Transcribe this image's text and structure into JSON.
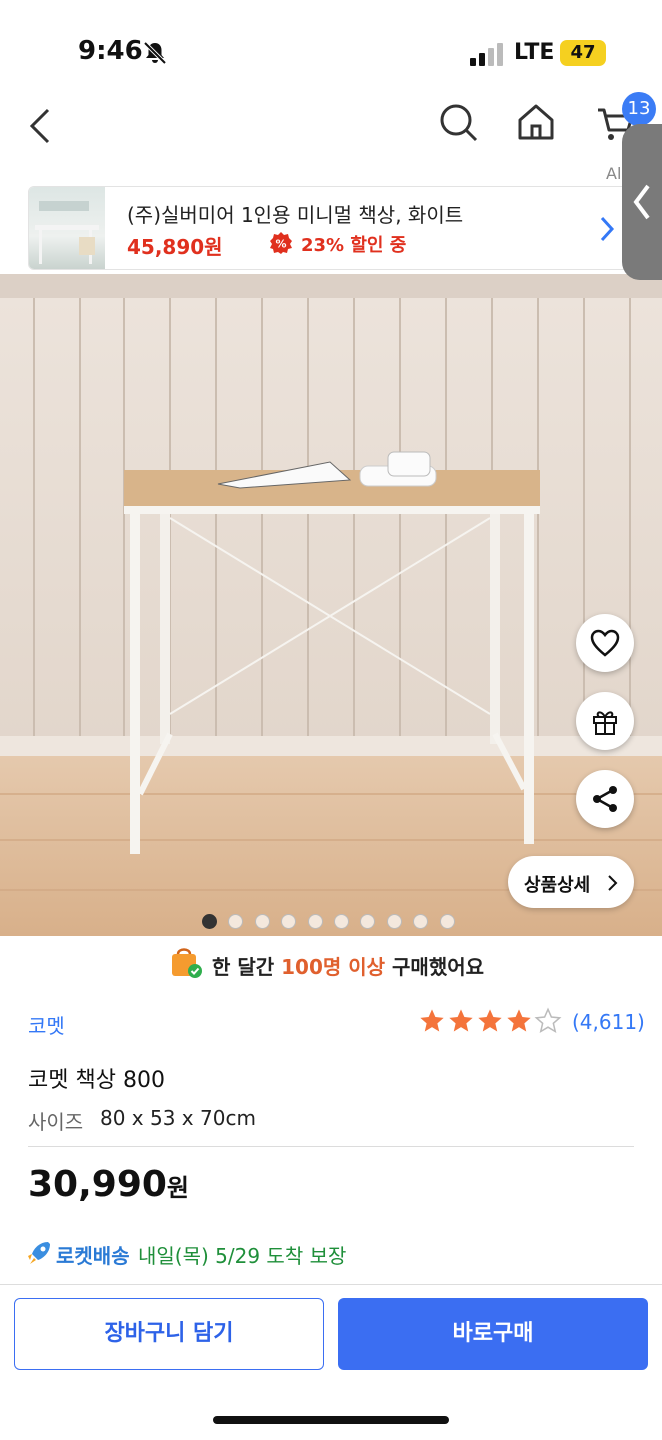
{
  "status_bar": {
    "time": "9:46",
    "network": "LTE",
    "battery": "47"
  },
  "header": {
    "cart_count": "13",
    "cart_label": "Al"
  },
  "banner": {
    "title": "(주)실버미어 1인용 미니멀 책상, 화이트",
    "price": "45,890원",
    "discount": "23% 할인 중"
  },
  "image": {
    "detail_label": "상품상세",
    "dots_total": 10,
    "dots_active": 0
  },
  "social_proof": {
    "prefix": "한 달간 ",
    "highlight": "100명 이상",
    "suffix": " 구매했어요"
  },
  "product": {
    "brand": "코멧",
    "rating": 4,
    "review_count": "(4,611)",
    "name": "코멧 책상 800",
    "size_label": "사이즈",
    "size_value": "80 x 53 x 70cm",
    "price": "30,990",
    "price_unit": "원",
    "rocket_label": "로켓배송",
    "delivery": "내일(목) 5/29 도착 보장"
  },
  "actions": {
    "cart_button": "장바구니 담기",
    "buy_button": "바로구매"
  },
  "colors": {
    "accent": "#3b6ef2",
    "sale": "#e0301e",
    "star": "#f4743b",
    "link": "#3478f6"
  }
}
